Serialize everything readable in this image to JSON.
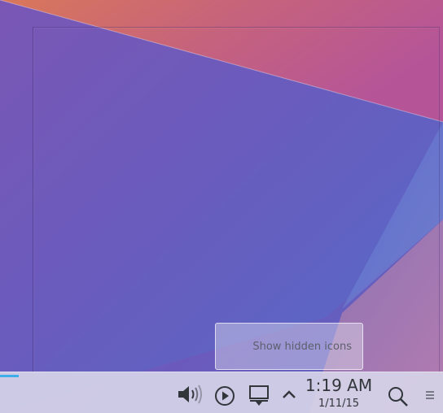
{
  "tooltip": {
    "text": "Show hidden icons"
  },
  "tray": {
    "icons": [
      "volume-icon",
      "media-player-icon",
      "device-notifier-icon",
      "expand-arrow-icon",
      "search-icon",
      "hamburger-menu-icon"
    ]
  },
  "clock": {
    "time": "1:19 AM",
    "date": "1/11/15"
  },
  "colors": {
    "accent": "#3daee9",
    "panel_bg": "#d6d4e8",
    "panel_icon": "#31363b",
    "tooltip_text": "#5d5f6d"
  }
}
